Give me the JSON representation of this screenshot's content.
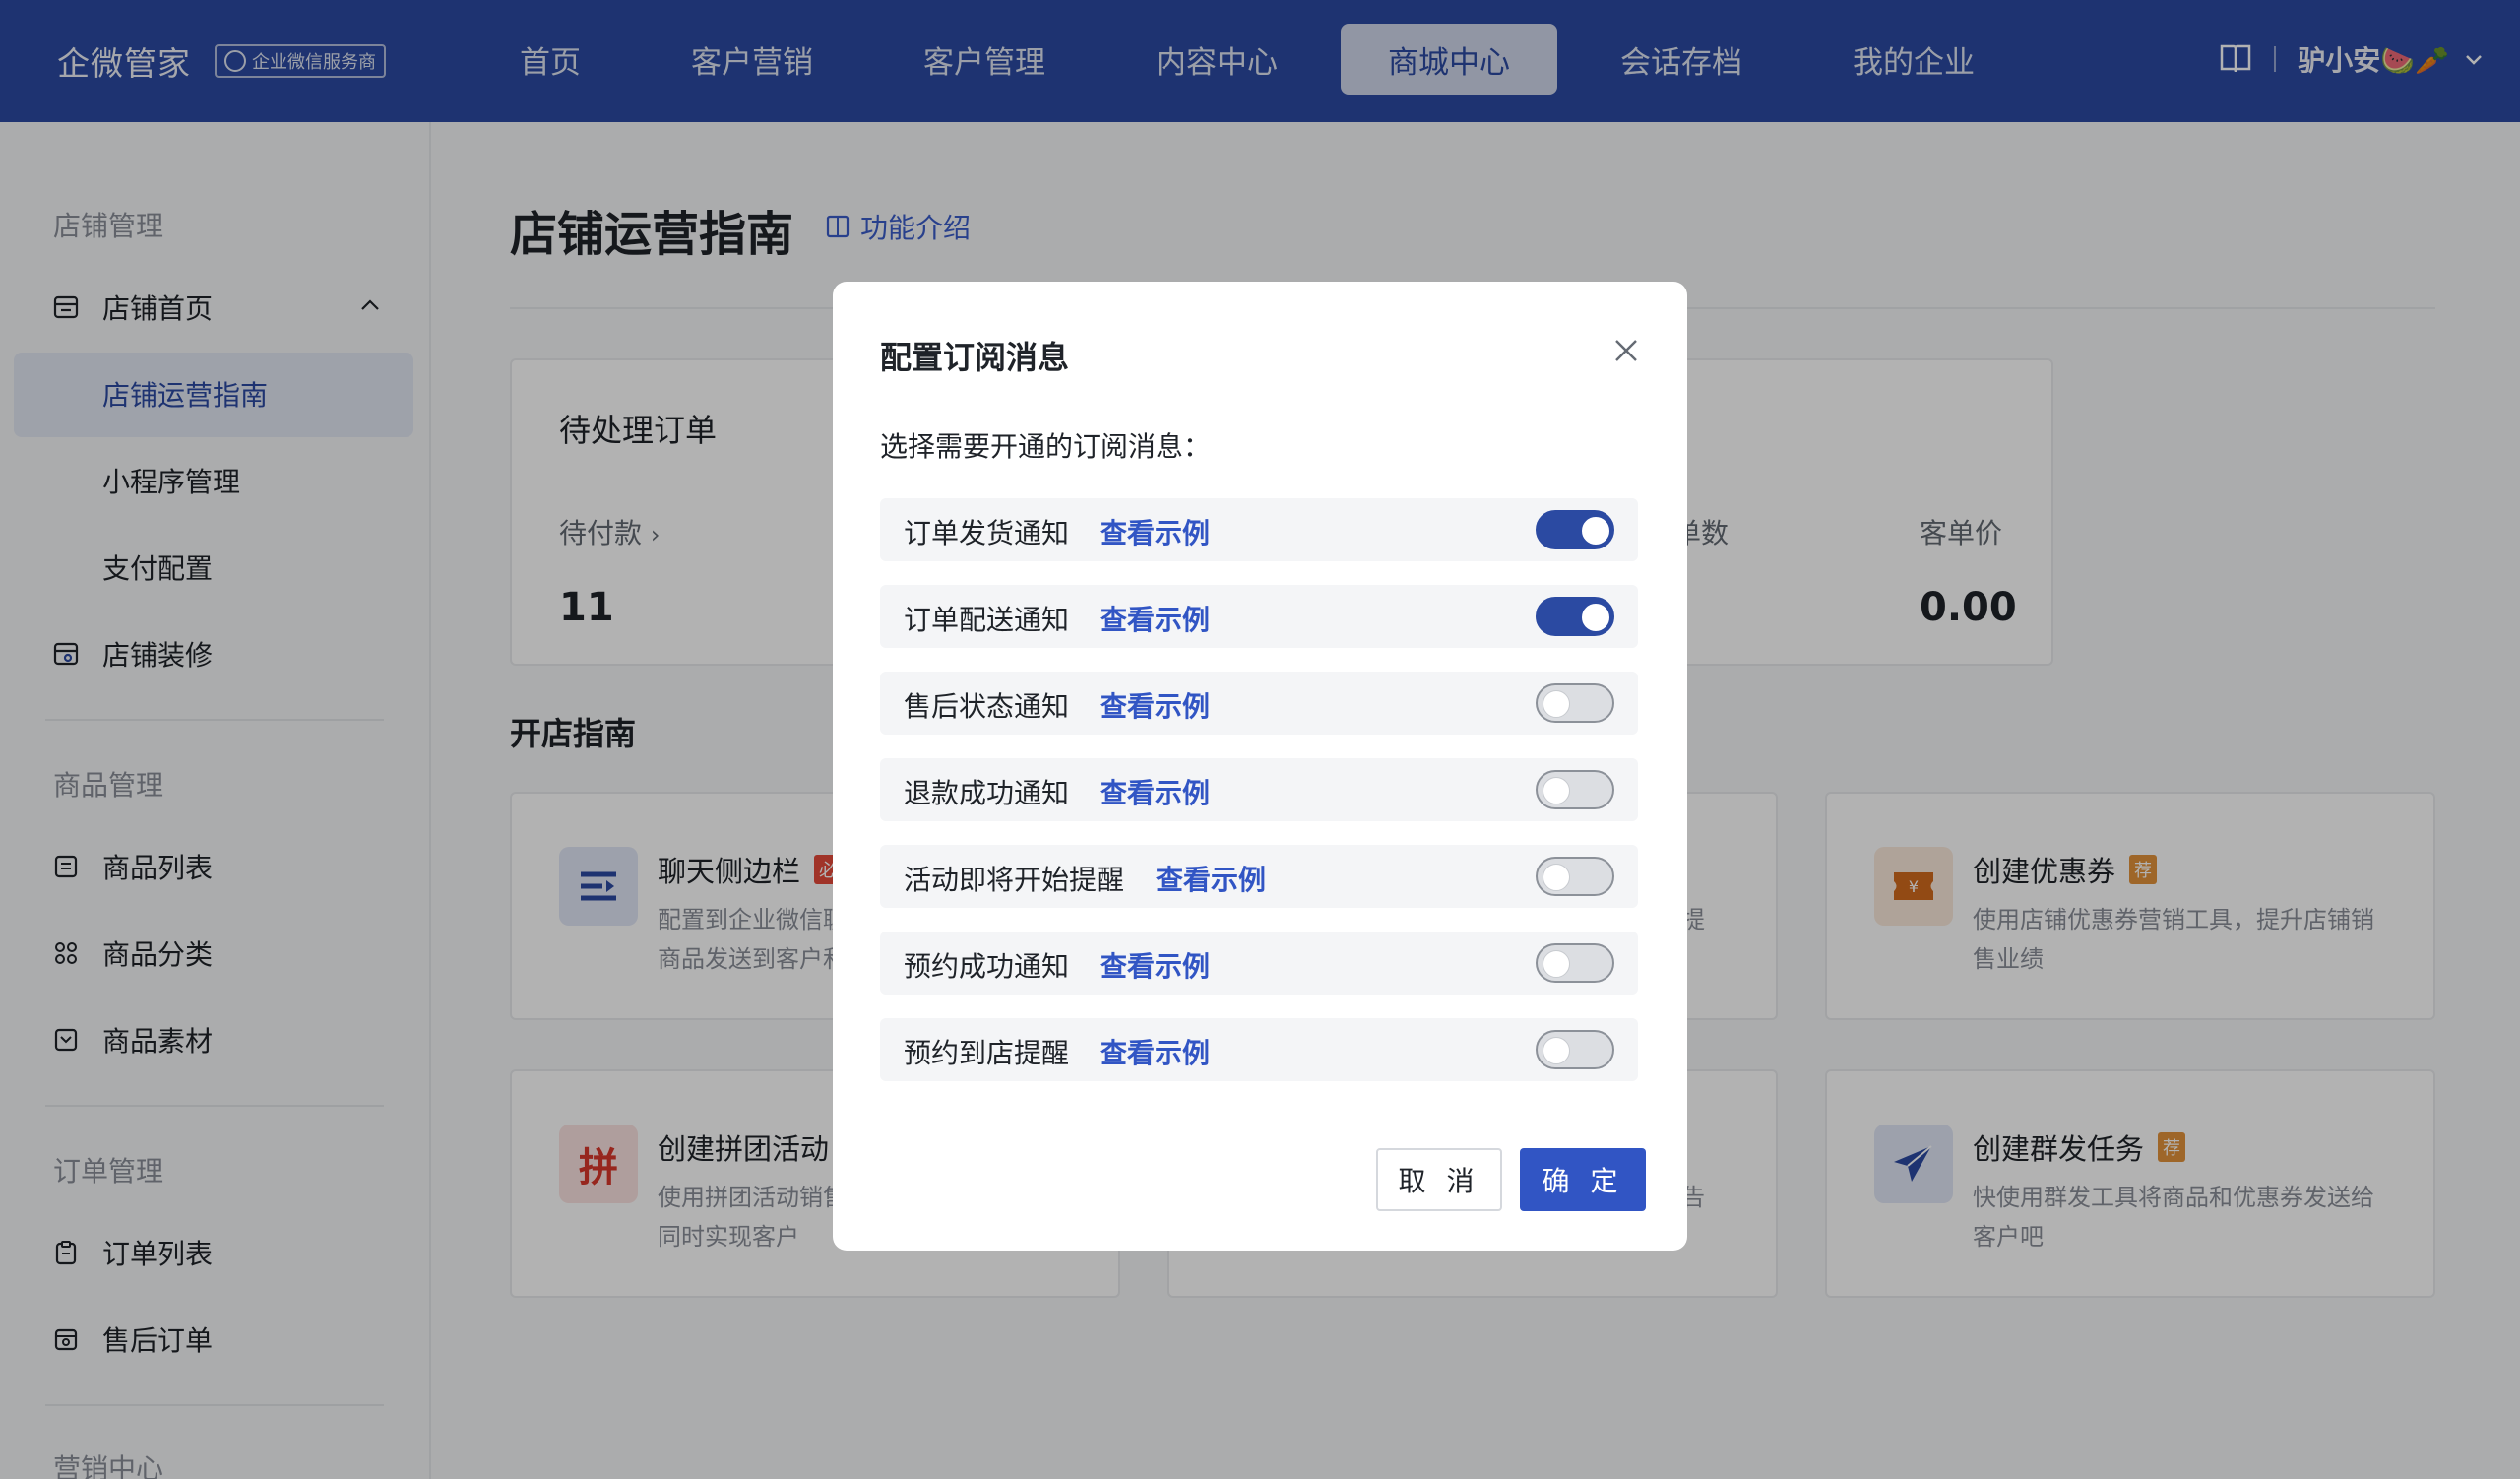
{
  "app": {
    "name": "企微管家",
    "badge": "企业微信服务商",
    "user": "驴小安🍉🥕"
  },
  "nav": {
    "items": [
      "首页",
      "客户营销",
      "客户管理",
      "内容中心",
      "商城中心",
      "会话存档",
      "我的企业"
    ],
    "active": "商城中心"
  },
  "sidebar": {
    "group_store": "店铺管理",
    "store_home": "店铺首页",
    "store_guide": "店铺运营指南",
    "miniapp": "小程序管理",
    "payment": "支付配置",
    "decoration": "店铺装修",
    "group_goods": "商品管理",
    "goods_list": "商品列表",
    "goods_category": "商品分类",
    "goods_material": "商品素材",
    "group_order": "订单管理",
    "order_list": "订单列表",
    "aftersale": "售后订单",
    "group_marketing": "营销中心"
  },
  "main": {
    "title": "店铺运营指南",
    "intro_link": "功能介绍",
    "pending_title": "待处理订单",
    "stat_pending_label": "待付款",
    "stat_pending_value": "11",
    "stat_orders_label": "单数",
    "stat_avg_label": "客单价",
    "stat_avg_value": "0.00",
    "guide_heading": "开店指南",
    "cards": [
      {
        "title": "聊天侧边栏",
        "tag": "必",
        "desc": "配置到企业微信聊天侧边栏，可快速将商品发送到客户和群"
      },
      {
        "title": "",
        "tag": "",
        "desc": "提"
      },
      {
        "title": "创建优惠券",
        "tag": "荐",
        "desc": "使用店铺优惠券营销工具，提升店铺销售业绩"
      },
      {
        "title": "创建拼团活动",
        "tag": "",
        "desc": "使用拼团活动销售商品，营造抢购氛，同时实现客户"
      },
      {
        "title": "",
        "tag": "",
        "desc": "告"
      },
      {
        "title": "创建群发任务",
        "tag": "荐",
        "desc": "快使用群发工具将商品和优惠券发送给客户吧"
      }
    ]
  },
  "modal": {
    "title": "配置订阅消息",
    "subtitle": "选择需要开通的订阅消息：",
    "example_link": "查看示例",
    "items": [
      {
        "label": "订单发货通知",
        "on": true
      },
      {
        "label": "订单配送通知",
        "on": true
      },
      {
        "label": "售后状态通知",
        "on": false
      },
      {
        "label": "退款成功通知",
        "on": false
      },
      {
        "label": "活动即将开始提醒",
        "on": false
      },
      {
        "label": "预约成功通知",
        "on": false
      },
      {
        "label": "预约到店提醒",
        "on": false
      }
    ],
    "cancel_label": "取 消",
    "confirm_label": "确 定"
  },
  "colors": {
    "brand": "#2b4aa2",
    "link": "#3155c4",
    "toggle_on": "#2b4aa2",
    "toggle_off": "#dcdee2"
  }
}
